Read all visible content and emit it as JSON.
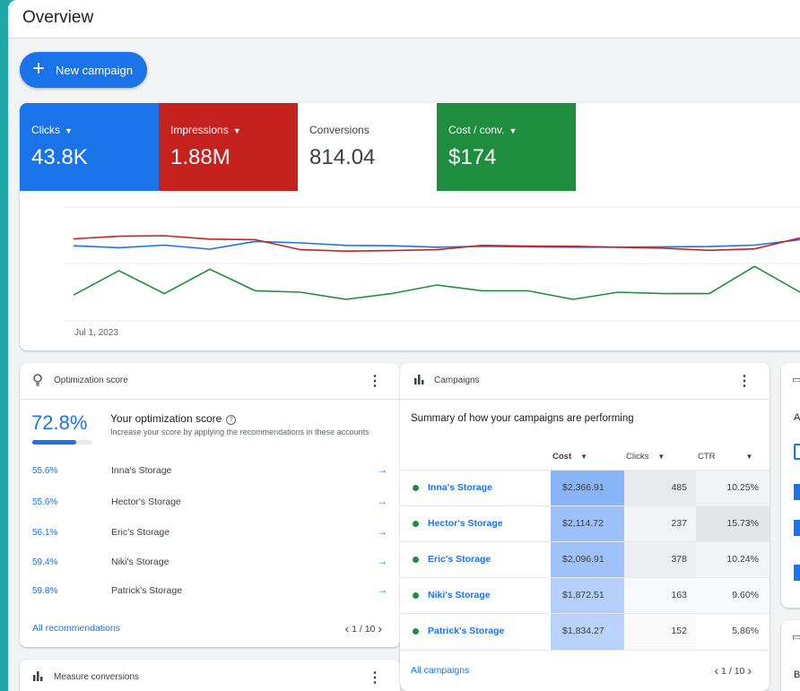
{
  "header": {
    "title": "Overview"
  },
  "new_campaign": {
    "label": "New campaign"
  },
  "metrics": [
    {
      "label": "Clicks",
      "value": "43.8K",
      "color": "#1a73e8",
      "caret": true
    },
    {
      "label": "Impressions",
      "value": "1.88M",
      "color": "#c5221f",
      "caret": true
    },
    {
      "label": "Conversions",
      "value": "814.04",
      "color": "#ffffff",
      "caret": false
    },
    {
      "label": "Cost / conv.",
      "value": "$174",
      "color": "#1e8e3e",
      "caret": true
    }
  ],
  "chart_data": {
    "type": "line",
    "x_start_label": "Jul 1, 2023",
    "series": [
      {
        "color": "#1a73e8",
        "values": [
          0.62,
          0.55,
          0.64,
          0.5,
          0.77,
          0.72,
          0.63,
          0.62,
          0.57,
          0.6,
          0.58,
          0.57,
          0.57,
          0.58,
          0.59,
          0.64,
          0.83
        ]
      },
      {
        "color": "#c5221f",
        "values": [
          0.86,
          0.95,
          0.97,
          0.85,
          0.83,
          0.48,
          0.43,
          0.45,
          0.48,
          0.63,
          0.61,
          0.6,
          0.57,
          0.53,
          0.46,
          0.51,
          0.89
        ]
      },
      {
        "color": "#1e8e3e",
        "values": [
          -1.1,
          -0.25,
          -1.05,
          -0.2,
          -0.95,
          -1.0,
          -1.25,
          -1.05,
          -0.75,
          -0.95,
          -0.95,
          -1.25,
          -1.0,
          -1.05,
          -1.05,
          -0.1,
          -1.0
        ]
      }
    ]
  },
  "optimization": {
    "title": "Optimization score",
    "score": "72.8%",
    "score_fraction": 0.728,
    "heading": "Your optimization score",
    "description": "Increase your score by applying the recommendations in these accounts",
    "rows": [
      {
        "pct": "55.6%",
        "account": "Inna's Storage"
      },
      {
        "pct": "55.6%",
        "account": "Hector's Storage"
      },
      {
        "pct": "56.1%",
        "account": "Eric's Storage"
      },
      {
        "pct": "59.4%",
        "account": "Niki's Storage"
      },
      {
        "pct": "59.8%",
        "account": "Patrick's Storage"
      }
    ],
    "footer_link": "All recommendations",
    "pager": "1 / 10"
  },
  "measure": {
    "title": "Measure conversions"
  },
  "campaigns": {
    "title": "Campaigns",
    "summary": "Summary of how your campaigns are performing",
    "columns": {
      "cost": "Cost",
      "clicks": "Clicks",
      "ctr": "CTR"
    },
    "rows": [
      {
        "name": "Inna's Storage",
        "cost": "$2,366.91",
        "clicks": "485",
        "ctr": "10.25%"
      },
      {
        "name": "Hector's Storage",
        "cost": "$2,114.72",
        "clicks": "237",
        "ctr": "15.73%"
      },
      {
        "name": "Eric's Storage",
        "cost": "$2,096.91",
        "clicks": "378",
        "ctr": "10.24%"
      },
      {
        "name": "Niki's Storage",
        "cost": "$1,872.51",
        "clicks": "163",
        "ctr": "9.60%"
      },
      {
        "name": "Patrick's Storage",
        "cost": "$1,834.27",
        "clicks": "152",
        "ctr": "5.86%"
      }
    ],
    "footer_link": "All campaigns",
    "pager": "1 / 10"
  },
  "side": {
    "partial_text_1": "A",
    "partial_text_2": "B"
  }
}
